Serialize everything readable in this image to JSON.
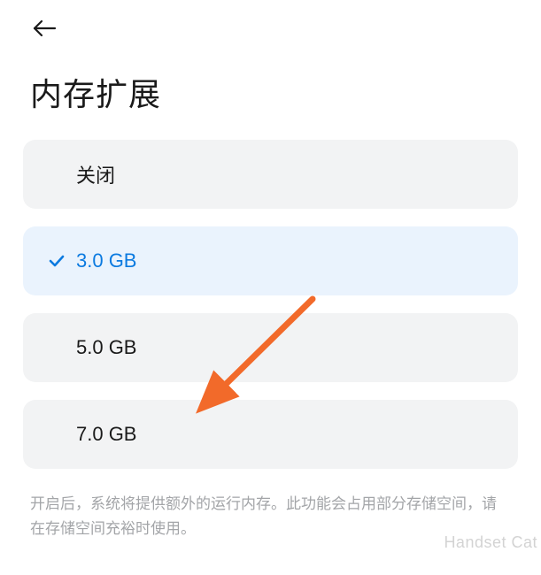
{
  "header": {
    "back_icon": "arrow-left"
  },
  "page_title": "内存扩展",
  "options": [
    {
      "label": "关闭",
      "selected": false
    },
    {
      "label": "3.0 GB",
      "selected": true
    },
    {
      "label": "5.0 GB",
      "selected": false
    },
    {
      "label": "7.0 GB",
      "selected": false
    }
  ],
  "description": "开启后，系统将提供额外的运行内存。此功能会占用部分存储空间，请在存储空间充裕时使用。",
  "annotation": {
    "arrow_color": "#f26a2a",
    "arrow_target": "5.0 GB"
  },
  "watermark": "Handset Cat"
}
